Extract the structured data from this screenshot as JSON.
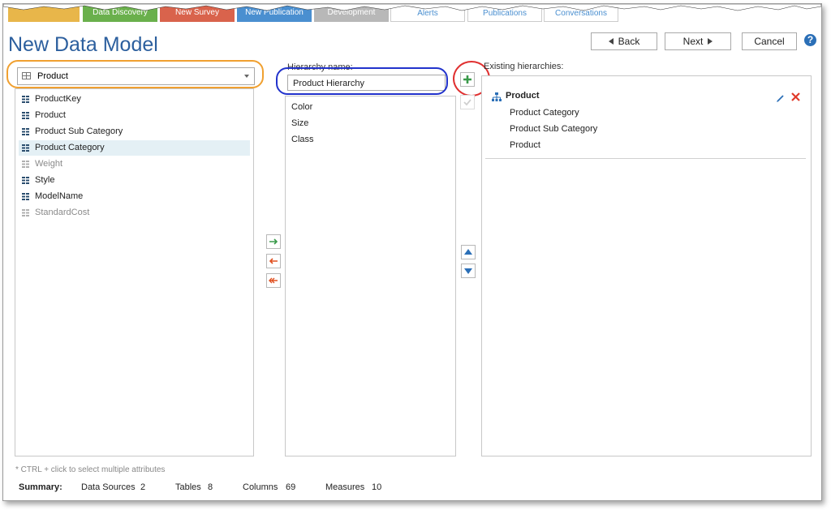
{
  "top_tabs": [
    {
      "label": "",
      "color": "#e8b64a"
    },
    {
      "label": "Data Discovery",
      "color": "#6ab04c"
    },
    {
      "label": "New Survey",
      "color": "#d9634c"
    },
    {
      "label": "New Publication",
      "color": "#4a8fd0"
    },
    {
      "label": "Development",
      "color": "#b8b8b8"
    },
    {
      "label": "Alerts",
      "color": "#ffffff"
    },
    {
      "label": "Publications",
      "color": "#ffffff"
    },
    {
      "label": "Conversations",
      "color": "#ffffff"
    }
  ],
  "page": {
    "title": "New Data Model"
  },
  "nav": {
    "back_label": "Back",
    "next_label": "Next",
    "cancel_label": "Cancel",
    "help_label": "?"
  },
  "table_select": {
    "value": "Product"
  },
  "attributes": [
    {
      "label": "ProductKey",
      "enabled": true,
      "selected": false
    },
    {
      "label": "Product",
      "enabled": true,
      "selected": false
    },
    {
      "label": "Product Sub Category",
      "enabled": true,
      "selected": false
    },
    {
      "label": "Product Category",
      "enabled": true,
      "selected": true
    },
    {
      "label": "Weight",
      "enabled": false,
      "selected": false
    },
    {
      "label": "Style",
      "enabled": true,
      "selected": false
    },
    {
      "label": "ModelName",
      "enabled": true,
      "selected": false
    },
    {
      "label": "StandardCost",
      "enabled": false,
      "selected": false
    }
  ],
  "hierarchy": {
    "name_label": "Hierarchy name:",
    "name_value": "Product Hierarchy",
    "levels": [
      "Color",
      "Size",
      "Class"
    ]
  },
  "existing": {
    "label": "Existing hierarchies:",
    "name": "Product",
    "levels": [
      "Product Category",
      "Product Sub Category",
      "Product"
    ]
  },
  "footer": {
    "hint": "* CTRL + click to select multiple attributes",
    "summary_label": "Summary:",
    "data_sources_label": "Data Sources",
    "data_sources_value": "2",
    "tables_label": "Tables",
    "tables_value": "8",
    "columns_label": "Columns",
    "columns_value": "69",
    "measures_label": "Measures",
    "measures_value": "10"
  },
  "colors": {
    "accent": "#2c5f9e",
    "highlight_orange": "#f0a030",
    "highlight_blue": "#2233cc",
    "highlight_red": "#e03030",
    "add_green": "#3a9a4a",
    "delete_red": "#e03a2a"
  }
}
